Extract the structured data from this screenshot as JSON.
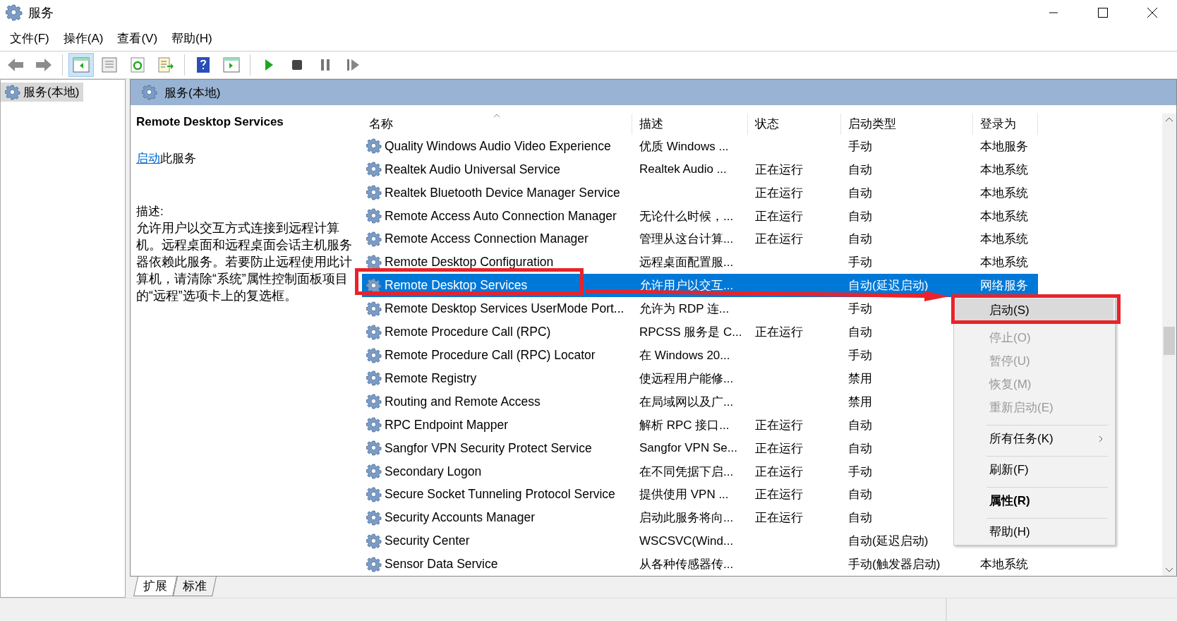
{
  "window": {
    "title": "服务"
  },
  "menu": [
    {
      "label": "文件(F)"
    },
    {
      "label": "操作(A)"
    },
    {
      "label": "查看(V)"
    },
    {
      "label": "帮助(H)"
    }
  ],
  "toolbar": [
    {
      "kind": "back",
      "selected": false
    },
    {
      "kind": "forward",
      "selected": false
    },
    {
      "kind": "sep"
    },
    {
      "kind": "tree",
      "selected": true
    },
    {
      "kind": "props",
      "selected": false
    },
    {
      "kind": "refresh",
      "selected": false
    },
    {
      "kind": "export",
      "selected": false
    },
    {
      "kind": "sep"
    },
    {
      "kind": "help",
      "selected": false
    },
    {
      "kind": "pane",
      "selected": false
    },
    {
      "kind": "sep"
    },
    {
      "kind": "play",
      "selected": false
    },
    {
      "kind": "stop",
      "selected": false
    },
    {
      "kind": "pause",
      "selected": false
    },
    {
      "kind": "resume",
      "selected": false
    }
  ],
  "tree": [
    {
      "label": "服务(本地)",
      "selected": true
    }
  ],
  "panel": {
    "title": "服务(本地)"
  },
  "details": {
    "title": "Remote Desktop Services",
    "action_link": "启动",
    "action_suffix": "此服务",
    "description_label": "描述:",
    "description": "允许用户以交互方式连接到远程计算机。远程桌面和远程桌面会话主机服务器依赖此服务。若要防止远程使用此计算机，请清除“系统”属性控制面板项目的“远程”选项卡上的复选框。"
  },
  "table": {
    "columns": [
      {
        "label": "名称",
        "sorted": true
      },
      {
        "label": "描述",
        "sorted": false
      },
      {
        "label": "状态",
        "sorted": false
      },
      {
        "label": "启动类型",
        "sorted": false
      },
      {
        "label": "登录为",
        "sorted": false
      }
    ],
    "rows": [
      {
        "name": "Quality Windows Audio Video Experience",
        "description": "优质 Windows ...",
        "status": "",
        "startup": "手动",
        "logon": "本地服务",
        "selected": false
      },
      {
        "name": "Realtek Audio Universal Service",
        "description": "Realtek Audio ...",
        "status": "正在运行",
        "startup": "自动",
        "logon": "本地系统",
        "selected": false
      },
      {
        "name": "Realtek Bluetooth Device Manager Service",
        "description": "",
        "status": "正在运行",
        "startup": "自动",
        "logon": "本地系统",
        "selected": false
      },
      {
        "name": "Remote Access Auto Connection Manager",
        "description": "无论什么时候，...",
        "status": "正在运行",
        "startup": "自动",
        "logon": "本地系统",
        "selected": false
      },
      {
        "name": "Remote Access Connection Manager",
        "description": "管理从这台计算...",
        "status": "正在运行",
        "startup": "自动",
        "logon": "本地系统",
        "selected": false
      },
      {
        "name": "Remote Desktop Configuration",
        "description": "远程桌面配置服...",
        "status": "",
        "startup": "手动",
        "logon": "本地系统",
        "selected": false
      },
      {
        "name": "Remote Desktop Services",
        "description": "允许用户以交互...",
        "status": "",
        "startup": "自动(延迟启动)",
        "logon": "网络服务",
        "selected": true
      },
      {
        "name": "Remote Desktop Services UserMode Port...",
        "description": "允许为 RDP 连...",
        "status": "",
        "startup": "手动",
        "logon": "",
        "selected": false
      },
      {
        "name": "Remote Procedure Call (RPC)",
        "description": "RPCSS 服务是 C...",
        "status": "正在运行",
        "startup": "自动",
        "logon": "",
        "selected": false
      },
      {
        "name": "Remote Procedure Call (RPC) Locator",
        "description": "在 Windows 20...",
        "status": "",
        "startup": "手动",
        "logon": "",
        "selected": false
      },
      {
        "name": "Remote Registry",
        "description": "使远程用户能修...",
        "status": "",
        "startup": "禁用",
        "logon": "",
        "selected": false
      },
      {
        "name": "Routing and Remote Access",
        "description": "在局域网以及广...",
        "status": "",
        "startup": "禁用",
        "logon": "",
        "selected": false
      },
      {
        "name": "RPC Endpoint Mapper",
        "description": "解析 RPC 接口...",
        "status": "正在运行",
        "startup": "自动",
        "logon": "",
        "selected": false
      },
      {
        "name": "Sangfor VPN Security Protect Service",
        "description": "Sangfor VPN Se...",
        "status": "正在运行",
        "startup": "自动",
        "logon": "",
        "selected": false
      },
      {
        "name": "Secondary Logon",
        "description": "在不同凭据下启...",
        "status": "正在运行",
        "startup": "手动",
        "logon": "",
        "selected": false
      },
      {
        "name": "Secure Socket Tunneling Protocol Service",
        "description": "提供使用 VPN ...",
        "status": "正在运行",
        "startup": "自动",
        "logon": "",
        "selected": false
      },
      {
        "name": "Security Accounts Manager",
        "description": "启动此服务将向...",
        "status": "正在运行",
        "startup": "自动",
        "logon": "",
        "selected": false
      },
      {
        "name": "Security Center",
        "description": "WSCSVC(Wind...",
        "status": "",
        "startup": "自动(延迟启动)",
        "logon": "",
        "selected": false
      },
      {
        "name": "Sensor Data Service",
        "description": "从各种传感器传...",
        "status": "",
        "startup": "手动(触发器启动)",
        "logon": "本地系统",
        "selected": false
      }
    ]
  },
  "bottom_tabs": [
    {
      "label": "扩展",
      "selected": true
    },
    {
      "label": "标准",
      "selected": false
    }
  ],
  "context_menu": [
    {
      "label": "启动(S)",
      "disabled": false,
      "bold": false,
      "highlighted": true,
      "submenu": false,
      "separator_before": false
    },
    {
      "label": "停止(O)",
      "disabled": true,
      "bold": false,
      "highlighted": false,
      "submenu": false,
      "separator_before": false
    },
    {
      "label": "暂停(U)",
      "disabled": true,
      "bold": false,
      "highlighted": false,
      "submenu": false,
      "separator_before": false
    },
    {
      "label": "恢复(M)",
      "disabled": true,
      "bold": false,
      "highlighted": false,
      "submenu": false,
      "separator_before": false
    },
    {
      "label": "重新启动(E)",
      "disabled": true,
      "bold": false,
      "highlighted": false,
      "submenu": false,
      "separator_before": false
    },
    {
      "label": "所有任务(K)",
      "disabled": false,
      "bold": false,
      "highlighted": false,
      "submenu": true,
      "separator_before": true
    },
    {
      "label": "刷新(F)",
      "disabled": false,
      "bold": false,
      "highlighted": false,
      "submenu": false,
      "separator_before": true
    },
    {
      "label": "属性(R)",
      "disabled": false,
      "bold": true,
      "highlighted": false,
      "submenu": false,
      "separator_before": true
    },
    {
      "label": "帮助(H)",
      "disabled": false,
      "bold": false,
      "highlighted": false,
      "submenu": false,
      "separator_before": true
    }
  ]
}
